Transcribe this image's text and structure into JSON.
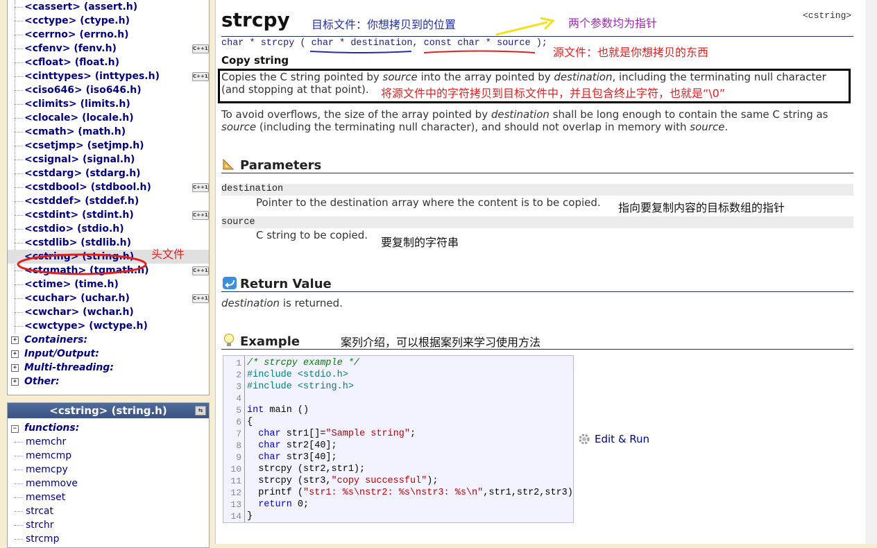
{
  "sidebar": {
    "headers": [
      {
        "label": "<cassert> (assert.h)",
        "cpp": false
      },
      {
        "label": "<cctype> (ctype.h)",
        "cpp": false
      },
      {
        "label": "<cerrno> (errno.h)",
        "cpp": false
      },
      {
        "label": "<cfenv> (fenv.h)",
        "cpp": true
      },
      {
        "label": "<cfloat> (float.h)",
        "cpp": false
      },
      {
        "label": "<cinttypes> (inttypes.h)",
        "cpp": true
      },
      {
        "label": "<ciso646> (iso646.h)",
        "cpp": false
      },
      {
        "label": "<climits> (limits.h)",
        "cpp": false
      },
      {
        "label": "<clocale> (locale.h)",
        "cpp": false
      },
      {
        "label": "<cmath> (math.h)",
        "cpp": false
      },
      {
        "label": "<csetjmp> (setjmp.h)",
        "cpp": false
      },
      {
        "label": "<csignal> (signal.h)",
        "cpp": false
      },
      {
        "label": "<cstdarg> (stdarg.h)",
        "cpp": false
      },
      {
        "label": "<cstdbool> (stdbool.h)",
        "cpp": true
      },
      {
        "label": "<cstddef> (stddef.h)",
        "cpp": false
      },
      {
        "label": "<cstdint> (stdint.h)",
        "cpp": true
      },
      {
        "label": "<cstdio> (stdio.h)",
        "cpp": false
      },
      {
        "label": "<cstdlib> (stdlib.h)",
        "cpp": false
      },
      {
        "label": "<cstring> (string.h)",
        "cpp": false,
        "active": true
      },
      {
        "label": "<ctgmath> (tgmath.h)",
        "cpp": true
      },
      {
        "label": "<ctime> (time.h)",
        "cpp": false
      },
      {
        "label": "<cuchar> (uchar.h)",
        "cpp": true
      },
      {
        "label": "<cwchar> (wchar.h)",
        "cpp": false
      },
      {
        "label": "<cwctype> (wctype.h)",
        "cpp": false
      }
    ],
    "cpp_badge": "C++11",
    "categories": [
      "Containers:",
      "Input/Output:",
      "Multi-threading:",
      "Other:"
    ],
    "header_note": "头文件",
    "panel_title": "<cstring> (string.h)",
    "functions_label": "functions:",
    "functions": [
      "memchr",
      "memcmp",
      "memcpy",
      "memmove",
      "memset",
      "strcat",
      "strchr",
      "strcmp"
    ]
  },
  "main": {
    "title": "strcpy",
    "header_tag": "<cstring>",
    "note_dest_file": "目标文件：你想拷贝到的位置",
    "note_two_pointers": "两个参数均为指针",
    "signature": {
      "prefix": "char * strcpy ( ",
      "param1": "char * destination",
      "sep": ", ",
      "param2": "const char * source",
      "suffix": " );"
    },
    "note_source_file": "源文件：也就是你想拷贝的东西",
    "subtitle": "Copy string",
    "desc1_a": "Copies the C string pointed by ",
    "desc1_b": "source",
    "desc1_c": " into the array pointed by ",
    "desc1_d": "destination",
    "desc1_e": ", including the terminating null character",
    "desc1_line2": "(and stopping at that point).",
    "note_copy": "将源文件中的字符拷贝到目标文件中，并且包含终止字符，也就是“\\0”",
    "desc2_a": "To avoid overflows, the size of the array pointed by ",
    "desc2_b": "destination",
    "desc2_c": " shall be long enough to contain the same C string as",
    "desc2_d": "source",
    "desc2_e": " (including the terminating null character), and should not overlap in memory with ",
    "desc2_f": "source",
    "desc2_g": ".",
    "parameters_title": "Parameters",
    "param_dest_name": "destination",
    "param_dest_desc": "Pointer to the destination array where the content is to be copied.",
    "note_param_dest": "指向要复制内容的目标数组的指针",
    "param_src_name": "source",
    "param_src_desc": "C string to be copied.",
    "note_param_src": "要复制的字符串",
    "return_title": "Return Value",
    "return_a": "destination",
    "return_b": " is returned.",
    "example_title": "Example",
    "note_example": "案列介绍，可以根据案列来学习使用方法",
    "edit_run": "Edit & Run",
    "code_lines": [
      "/* strcpy example */",
      "#include <stdio.h>",
      "#include <string.h>",
      "",
      "int main ()",
      "{",
      "  char str1[]=\"Sample string\";",
      "  char str2[40];",
      "  char str3[40];",
      "  strcpy (str2,str1);",
      "  strcpy (str3,\"copy successful\");",
      "  printf (\"str1: %s\\nstr2: %s\\nstr3: %s\\n\",str1,str2,str3);",
      "  return 0;",
      "}"
    ]
  },
  "colors": {
    "link_navy": "#000080",
    "annotation_red": "#e02020",
    "annotation_purple": "#9c27b0",
    "annotation_blue": "#2230a8",
    "arrow_yellow": "#f5e11a"
  }
}
